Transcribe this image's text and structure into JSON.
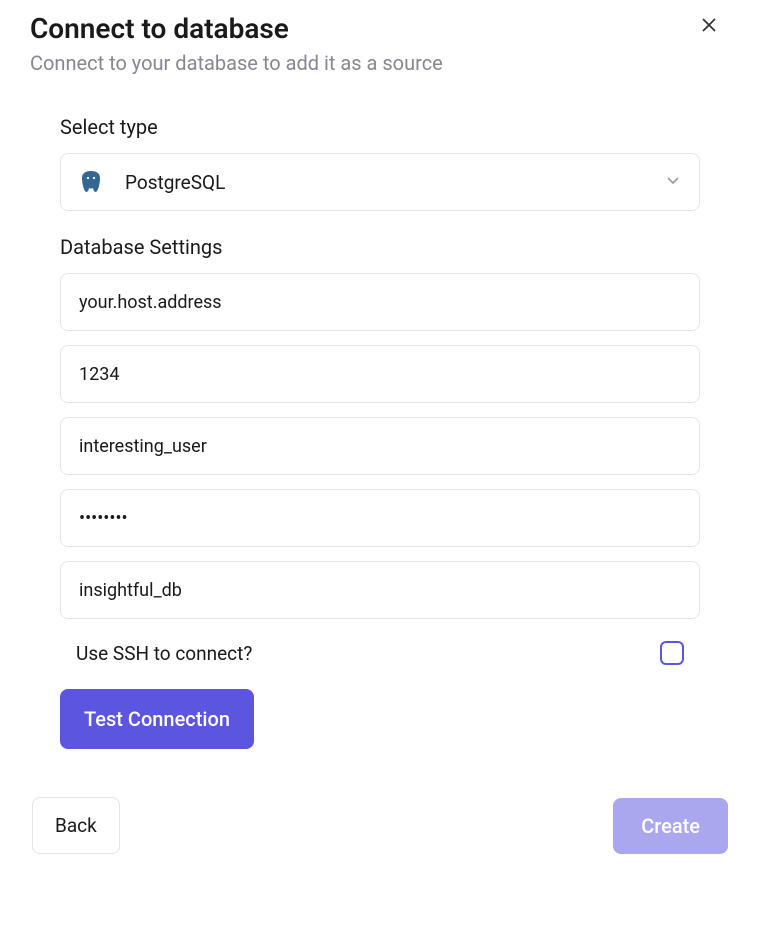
{
  "header": {
    "title": "Connect to database",
    "subtitle": "Connect to your database to add it as a source"
  },
  "form": {
    "select_type_label": "Select type",
    "selected_db": "PostgreSQL",
    "database_settings_label": "Database Settings",
    "host_value": "your.host.address",
    "port_value": "1234",
    "user_value": "interesting_user",
    "password_value": "••••••••",
    "db_name_value": "insightful_db",
    "ssh_label": "Use SSH to connect?",
    "ssh_checked": false,
    "test_button_label": "Test Connection"
  },
  "footer": {
    "back_label": "Back",
    "create_label": "Create"
  }
}
